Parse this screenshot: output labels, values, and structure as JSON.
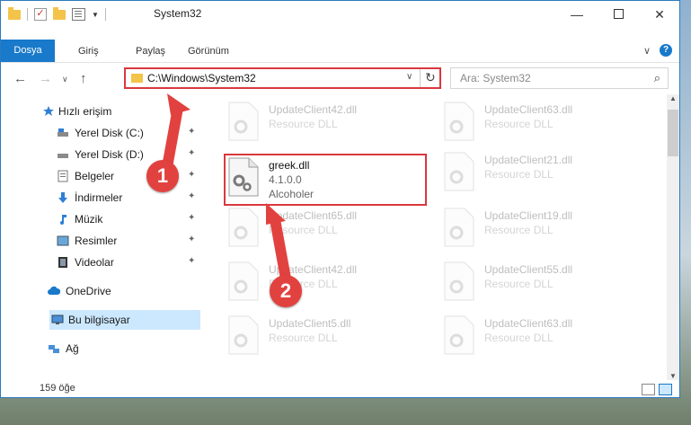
{
  "window": {
    "title": "System32",
    "minimize_label": "—",
    "close_label": "✕"
  },
  "ribbon": {
    "tabs": [
      "Dosya",
      "Giriş",
      "Paylaş",
      "Görünüm"
    ],
    "help_label": "?"
  },
  "address": {
    "path": "C:\\Windows\\System32",
    "search_placeholder": "Ara: System32"
  },
  "nav": {
    "items": [
      {
        "label": "Hızlı erişim",
        "icon": "star-icon"
      },
      {
        "label": "Yerel Disk (C:)",
        "icon": "drive-icon",
        "pinned": true
      },
      {
        "label": "Yerel Disk (D:)",
        "icon": "drive-icon",
        "pinned": true
      },
      {
        "label": "Belgeler",
        "icon": "documents-icon",
        "pinned": true
      },
      {
        "label": "İndirmeler",
        "icon": "downloads-icon",
        "pinned": true
      },
      {
        "label": "Müzik",
        "icon": "music-icon",
        "pinned": true
      },
      {
        "label": "Resimler",
        "icon": "pictures-icon",
        "pinned": true
      },
      {
        "label": "Videolar",
        "icon": "videos-icon",
        "pinned": true
      },
      {
        "label": "OneDrive",
        "icon": "cloud-icon"
      },
      {
        "label": "Bu bilgisayar",
        "icon": "computer-icon",
        "selected": true
      },
      {
        "label": "Ağ",
        "icon": "network-icon"
      }
    ]
  },
  "files": [
    {
      "name": "UpdateClient42.dll",
      "type": "Resource DLL"
    },
    {
      "name": "UpdateClient63.dll",
      "type": "Resource DLL"
    },
    {
      "name": "greek.dll",
      "version": "4.1.0.0",
      "company": "Alcoholer"
    },
    {
      "name": "UpdateClient21.dll",
      "type": "Resource DLL"
    },
    {
      "name": "UpdateClient65.dll",
      "type": "Resource DLL"
    },
    {
      "name": "UpdateClient19.dll",
      "type": "Resource DLL"
    },
    {
      "name": "UpdateClient42.dll",
      "type": "Resource DLL"
    },
    {
      "name": "UpdateClient55.dll",
      "type": "Resource DLL"
    },
    {
      "name": "UpdateClient5.dll",
      "type": "Resource DLL"
    },
    {
      "name": "UpdateClient63.dll",
      "type": "Resource DLL"
    }
  ],
  "status": {
    "count": "159 öğe"
  },
  "callouts": [
    "1",
    "2"
  ],
  "colors": {
    "accent": "#1979ca",
    "highlight": "#d9383e"
  }
}
